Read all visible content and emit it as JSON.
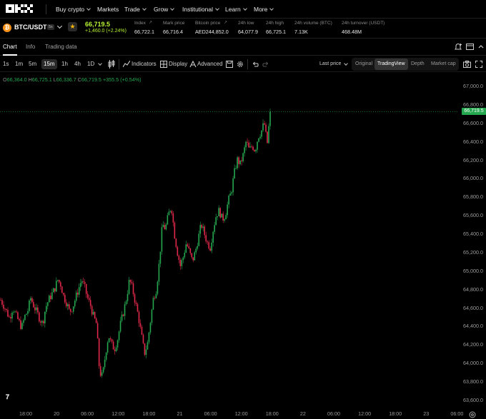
{
  "nav": {
    "items": [
      {
        "label": "Buy crypto",
        "dropdown": true
      },
      {
        "label": "Markets",
        "dropdown": false
      },
      {
        "label": "Trade",
        "dropdown": true
      },
      {
        "label": "Grow",
        "dropdown": true
      },
      {
        "label": "Institutional",
        "dropdown": true
      },
      {
        "label": "Learn",
        "dropdown": true
      },
      {
        "label": "More",
        "dropdown": true
      }
    ]
  },
  "ticker": {
    "coin_letter": "₿",
    "pair": "BTC/USDT",
    "leverage": "5x",
    "last_price": "66,719.5",
    "change": "+1,460.0 (+2.24%)",
    "stats": [
      {
        "label": "Index",
        "value": "66,722.1"
      },
      {
        "label": "Mark price",
        "value": "66,716.4"
      },
      {
        "label": "Bitcoin price",
        "value": "AED244,852.0"
      },
      {
        "label": "24h low",
        "value": "64,077.9"
      },
      {
        "label": "24h high",
        "value": "66,725.1"
      },
      {
        "label": "24h volume (BTC)",
        "value": "7.13K"
      },
      {
        "label": "24h turnover (USDT)",
        "value": "468.48M"
      }
    ]
  },
  "tabs": [
    "Chart",
    "Info",
    "Trading data"
  ],
  "toolbar": {
    "intervals": [
      "1s",
      "1m",
      "5m",
      "15m",
      "1h",
      "4h",
      "1D"
    ],
    "selected_interval": "15m",
    "indicators_label": "Indicators",
    "display_label": "Display",
    "advanced_label": "Advanced",
    "price_type": "Last price",
    "views": [
      "Original",
      "TradingView",
      "Depth",
      "Market cap"
    ],
    "selected_view": "TradingView"
  },
  "ohlc": {
    "o": "66,364.0",
    "h": "66,725.1",
    "l": "66,336.7",
    "c": "66,719.5",
    "chg": "+355.5 (+0.54%)"
  },
  "colors": {
    "up": "#25a750",
    "down": "#e0294a",
    "accent": "#b8f533"
  },
  "chart_data": {
    "type": "candlestick",
    "current_price": 66719.5,
    "ylim": [
      63600,
      67000
    ],
    "y_ticks": [
      "67,000.0",
      "66,800.0",
      "66,600.0",
      "66,400.0",
      "66,200.0",
      "66,000.0",
      "65,800.0",
      "65,600.0",
      "65,400.0",
      "65,200.0",
      "65,000.0",
      "64,800.0",
      "64,600.0",
      "64,400.0",
      "64,200.0",
      "64,000.0",
      "63,800.0",
      "63,600.0"
    ],
    "x_ticks": [
      "18:00",
      "20",
      "06:00",
      "12:00",
      "18:00",
      "21",
      "06:00",
      "12:00",
      "18:00",
      "22",
      "06:00",
      "12:00",
      "18:00",
      "23",
      "06:00"
    ],
    "close_path": [
      64680,
      64620,
      64550,
      64480,
      64600,
      64520,
      64450,
      64380,
      64500,
      64560,
      64700,
      64620,
      64550,
      64480,
      64420,
      64600,
      64680,
      64740,
      64800,
      64900,
      64850,
      64720,
      64650,
      64550,
      64600,
      64700,
      64800,
      64900,
      64820,
      64700,
      64620,
      64500,
      64420,
      63900,
      63850,
      64100,
      64300,
      64200,
      64150,
      64250,
      64420,
      64550,
      64700,
      64900,
      64800,
      64650,
      64500,
      64300,
      64100,
      64200,
      64450,
      64700,
      64800,
      65100,
      65500,
      65450,
      65600,
      65700,
      65400,
      65200,
      65050,
      65150,
      65300,
      65200,
      65100,
      65200,
      65350,
      65500,
      65400,
      65300,
      65250,
      65450,
      65600,
      65650,
      65550,
      65600,
      65750,
      65850,
      66050,
      66200,
      66150,
      66250,
      66400,
      66300,
      66350,
      66300,
      66450,
      66500,
      66600,
      66364,
      66719
    ]
  }
}
